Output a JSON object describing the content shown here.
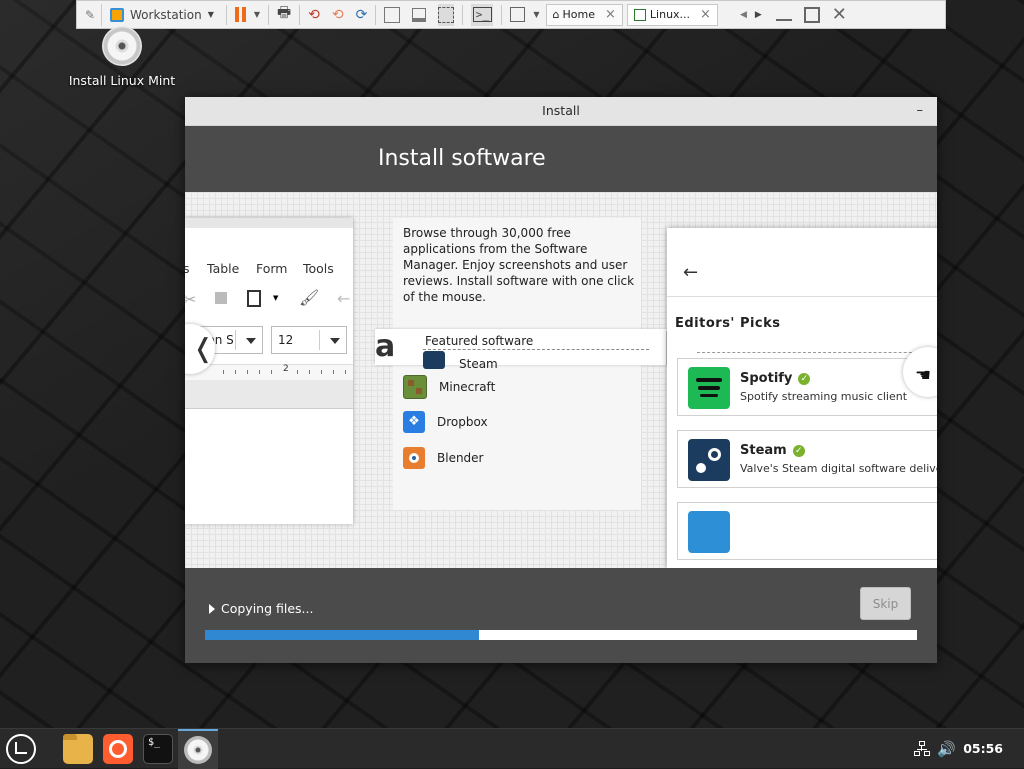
{
  "vmware_toolbar": {
    "menu_label": "Workstation",
    "tabs": [
      {
        "label": "Home"
      },
      {
        "label": "Linux..."
      }
    ],
    "close_symbol": "×"
  },
  "desktop": {
    "icon_label": "Install Linux Mint"
  },
  "window": {
    "title": "Install",
    "minimize_symbol": "–",
    "header_title": "Install software",
    "slide": {
      "office_menu": [
        "s",
        "Table",
        "Form",
        "Tools"
      ],
      "font_name": "ation S",
      "font_size": "12",
      "ruler_mark": "2",
      "prev_symbol": "❬",
      "description": "Browse through 30,000 free applications from the Software Manager. Enjoy screenshots and user reviews. Install software with one click of the mouse.",
      "featured_title": "Featured software",
      "featured_items": [
        {
          "name": "Steam",
          "icon": "steam-icon",
          "color": "#1b3c5e"
        },
        {
          "name": "Minecraft",
          "icon": "minecraft-icon",
          "color": "#6b8e3a"
        },
        {
          "name": "Dropbox",
          "icon": "dropbox-icon",
          "color": "#2a7de1"
        },
        {
          "name": "Blender",
          "icon": "blender-icon",
          "color": "#e87d2f"
        }
      ],
      "sm_section_title": "Editors' Picks",
      "sm_back_symbol": "←",
      "sm_cards": [
        {
          "name": "Spotify",
          "desc": "Spotify streaming music client",
          "color": "#1db954"
        },
        {
          "name": "Steam",
          "desc": "Valve's Steam digital software delivery",
          "color": "#1b3c5e"
        }
      ]
    },
    "status_text": "Copying files...",
    "skip_label": "Skip",
    "progress_fraction": 0.385,
    "accent_color": "#2f88d1"
  },
  "taskbar": {
    "clock": "05:56",
    "volume_symbol": "🔊"
  }
}
